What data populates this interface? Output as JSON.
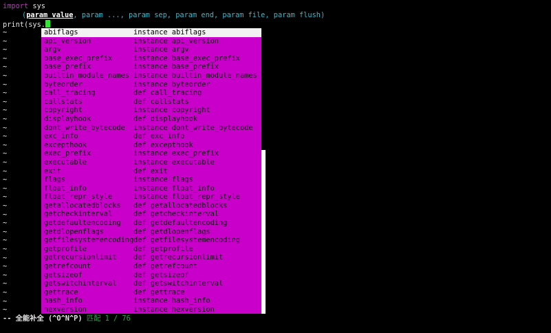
{
  "editor": {
    "line1": {
      "keyword": "import",
      "rest": " sys"
    },
    "signature": {
      "open": "(",
      "current": "param value",
      "rest": ", param ..., param sep, param end, param file, param flush)"
    },
    "line3": {
      "text": "print(sys."
    },
    "tilde": "~"
  },
  "popup": {
    "items": [
      {
        "word": "abiflags",
        "menu": "instance abiflags"
      },
      {
        "word": "api_version",
        "menu": "instance api_version"
      },
      {
        "word": "argv",
        "menu": "instance argv"
      },
      {
        "word": "base_exec_prefix",
        "menu": "instance base_exec_prefix"
      },
      {
        "word": "base_prefix",
        "menu": "instance base_prefix"
      },
      {
        "word": "builtin_module_names",
        "menu": "instance builtin_module_names"
      },
      {
        "word": "byteorder",
        "menu": "instance byteorder"
      },
      {
        "word": "call_tracing",
        "menu": "def call_tracing"
      },
      {
        "word": "callstats",
        "menu": "def callstats"
      },
      {
        "word": "copyright",
        "menu": "instance copyright"
      },
      {
        "word": "displayhook",
        "menu": "def displayhook"
      },
      {
        "word": "dont_write_bytecode",
        "menu": "instance dont_write_bytecode"
      },
      {
        "word": "exc_info",
        "menu": "def exc_info"
      },
      {
        "word": "excepthook",
        "menu": "def excepthook"
      },
      {
        "word": "exec_prefix",
        "menu": "instance exec_prefix"
      },
      {
        "word": "executable",
        "menu": "instance executable"
      },
      {
        "word": "exit",
        "menu": "def exit"
      },
      {
        "word": "flags",
        "menu": "instance flags"
      },
      {
        "word": "float_info",
        "menu": "instance float_info"
      },
      {
        "word": "float_repr_style",
        "menu": "instance float_repr_style"
      },
      {
        "word": "getallocatedblocks",
        "menu": "def getallocatedblocks"
      },
      {
        "word": "getcheckinterval",
        "menu": "def getcheckinterval"
      },
      {
        "word": "getdefaultencoding",
        "menu": "def getdefaultencoding"
      },
      {
        "word": "getdlopenflags",
        "menu": "def getdlopenflags"
      },
      {
        "word": "getfilesystemencoding",
        "menu": "def getfilesystemencoding"
      },
      {
        "word": "getprofile",
        "menu": "def getprofile"
      },
      {
        "word": "getrecursionlimit",
        "menu": "def getrecursionlimit"
      },
      {
        "word": "getrefcount",
        "menu": "def getrefcount"
      },
      {
        "word": "getsizeof",
        "menu": "def getsizeof"
      },
      {
        "word": "getswitchinterval",
        "menu": "def getswitchinterval"
      },
      {
        "word": "gettrace",
        "menu": "def gettrace"
      },
      {
        "word": "hash_info",
        "menu": "instance hash_info"
      },
      {
        "word": "hexversion",
        "menu": "instance hexversion"
      }
    ]
  },
  "status": {
    "mode": "-- 全能补全 (^O^N^P)",
    "match_label": "匹配",
    "match_count": "1 / 76"
  },
  "colors": {
    "background": "#000000",
    "popup": "#c900c9",
    "popup_selected": "#f2f2f2",
    "keyword": "#c230c2",
    "signature": "#3fb6c8",
    "cursor": "#33e633",
    "match": "#2fa64a"
  }
}
